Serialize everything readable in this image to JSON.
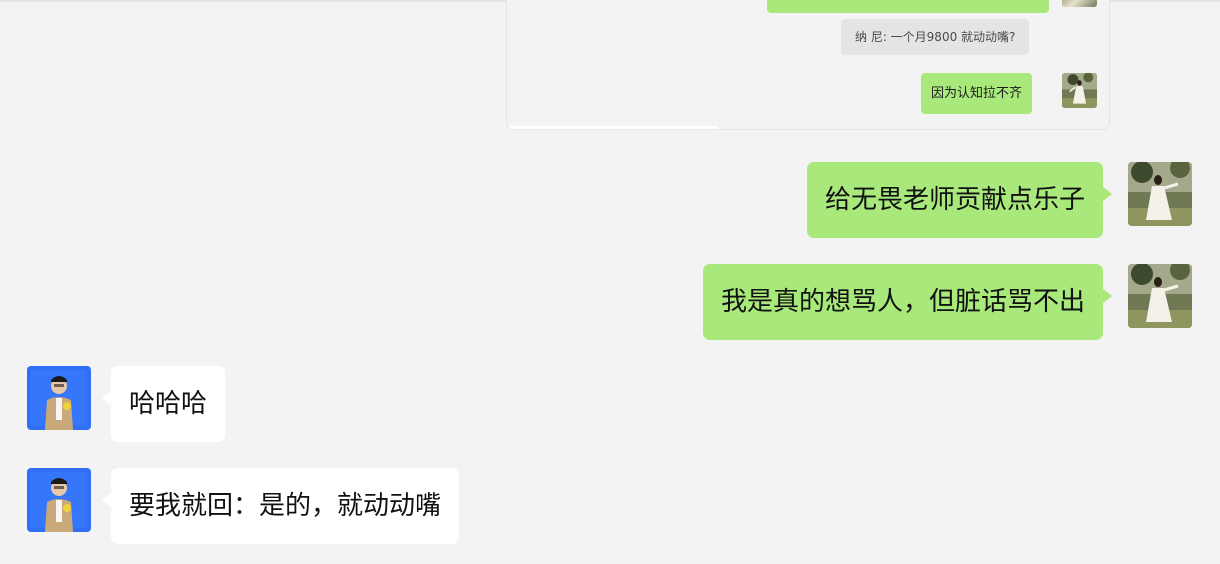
{
  "quoted_chat": {
    "messages": [
      {
        "sender": "other",
        "text": "纳 尼: 一个月9800  就动动嘴?"
      },
      {
        "sender": "self",
        "text": "因为认知拉不齐"
      }
    ],
    "progress_fraction": 0.35
  },
  "messages": [
    {
      "sender": "self",
      "text": "给无畏老师贡献点乐子"
    },
    {
      "sender": "self",
      "text": "我是真的想骂人，但脏话骂不出"
    },
    {
      "sender": "other",
      "text": "哈哈哈"
    },
    {
      "sender": "other",
      "text": "要我就回：是的，就动动嘴"
    }
  ],
  "colors": {
    "self_bubble": "#a9e97c",
    "other_bubble": "#ffffff",
    "background": "#f3f3f3",
    "quote_bubble": "#e4e4e4",
    "other_avatar_bg": "#2f6ef5"
  },
  "icons": {
    "self_avatar": "woman-in-white-dress-photo",
    "other_avatar": "man-on-blue-background-photo"
  }
}
